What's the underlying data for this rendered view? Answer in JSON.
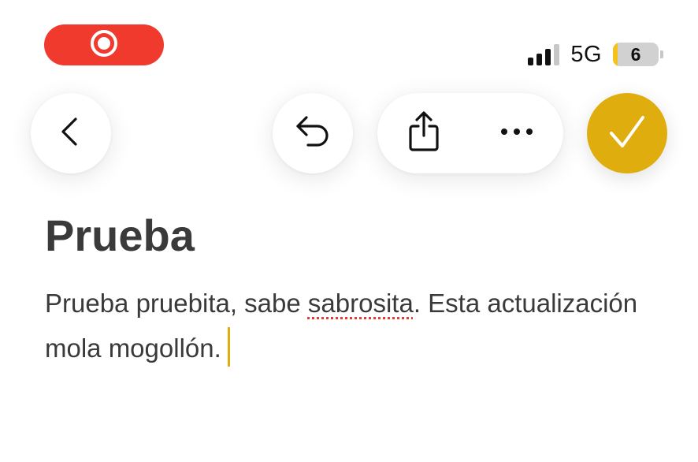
{
  "status_bar": {
    "record_indicator_icon": "record-icon",
    "network": "5G",
    "battery_level": "6",
    "signal_bars_active": 3,
    "signal_bars_total": 4
  },
  "toolbar": {
    "back_icon": "chevron-left-icon",
    "undo_icon": "undo-icon",
    "share_icon": "share-icon",
    "more_icon": "ellipsis-icon",
    "done_icon": "checkmark-icon"
  },
  "note": {
    "title": "Prueba",
    "body_before": "Prueba pruebita, sabe ",
    "body_misspelled": "sabrosita",
    "body_after": ". Esta actualización mola mogollón."
  },
  "colors": {
    "accent": "#e0ad0e",
    "record": "#f03a2e",
    "text": "#3a3a3a",
    "spellcheck": "#e53935"
  }
}
